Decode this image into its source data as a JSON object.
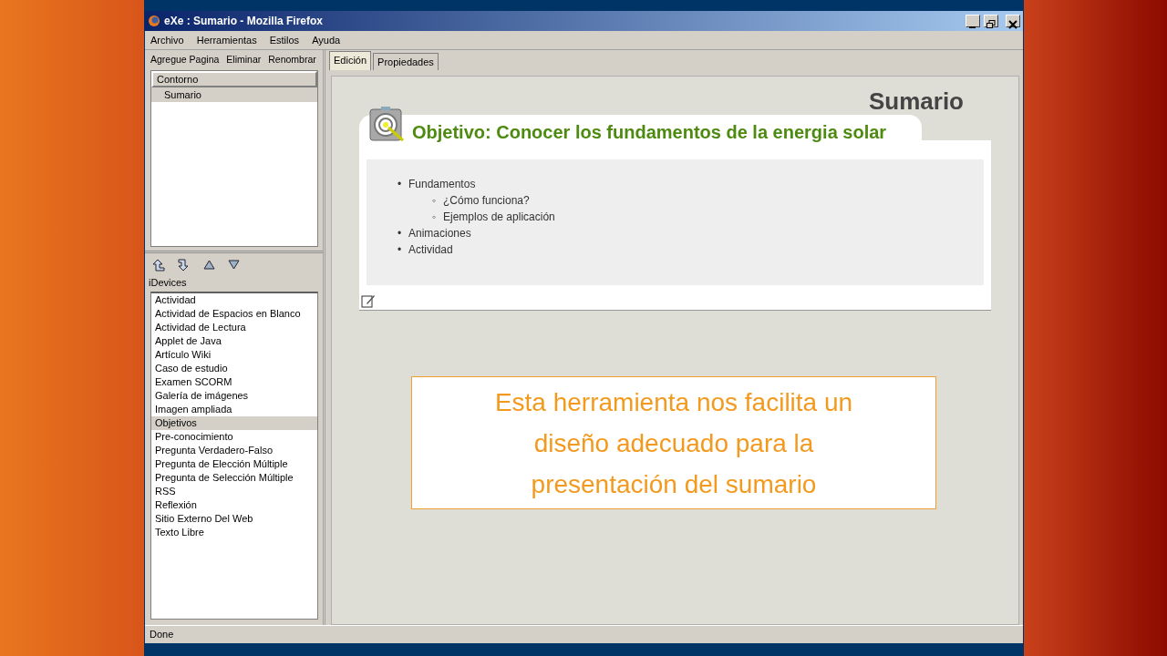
{
  "window": {
    "title": "eXe : Sumario - Mozilla Firefox"
  },
  "menu": [
    "Archivo",
    "Herramientas",
    "Estilos",
    "Ayuda"
  ],
  "outline_toolbar": [
    "Agregue Pagina",
    "Eliminar",
    "Renombrar"
  ],
  "outline": [
    {
      "label": "Contorno",
      "selected": false,
      "children": [
        {
          "label": "Sumario",
          "selected": true
        }
      ]
    }
  ],
  "idevices": {
    "heading": "iDevices",
    "items": [
      {
        "label": "Actividad",
        "selected": false
      },
      {
        "label": "Actividad de Espacios en Blanco",
        "selected": false
      },
      {
        "label": "Actividad de Lectura",
        "selected": false
      },
      {
        "label": "Applet de Java",
        "selected": false
      },
      {
        "label": "Artículo Wiki",
        "selected": false
      },
      {
        "label": "Caso de estudio",
        "selected": false
      },
      {
        "label": "Examen SCORM",
        "selected": false
      },
      {
        "label": "Galería de imágenes",
        "selected": false
      },
      {
        "label": "Imagen ampliada",
        "selected": false
      },
      {
        "label": "Objetivos",
        "selected": true
      },
      {
        "label": "Pre-conocimiento",
        "selected": false
      },
      {
        "label": "Pregunta Verdadero-Falso",
        "selected": false
      },
      {
        "label": "Pregunta de Elección Múltiple",
        "selected": false
      },
      {
        "label": "Pregunta de Selección Múltiple",
        "selected": false
      },
      {
        "label": "RSS",
        "selected": false
      },
      {
        "label": "Reflexión",
        "selected": false
      },
      {
        "label": "Sitio Externo Del Web",
        "selected": false
      },
      {
        "label": "Texto Libre",
        "selected": false
      }
    ]
  },
  "tabs": [
    {
      "label": "Edición",
      "selected": true
    },
    {
      "label": "Propiedades",
      "selected": false
    }
  ],
  "page": {
    "title": "Sumario",
    "idevice": {
      "title": "Objetivo: Conocer los fundamentos de la energia solar",
      "items": [
        {
          "marker": "•",
          "label": "Fundamentos",
          "children": [
            {
              "marker": "◦",
              "label": "¿Cómo funciona?"
            },
            {
              "marker": "◦",
              "label": "Ejemplos de aplicación"
            }
          ]
        },
        {
          "marker": "•",
          "label": "Animaciones"
        },
        {
          "marker": "•",
          "label": "Actividad"
        }
      ]
    }
  },
  "callout": {
    "text": "Esta herramienta nos facilita un diseño adecuado para la presentación del sumario"
  },
  "status_bar": "Done"
}
